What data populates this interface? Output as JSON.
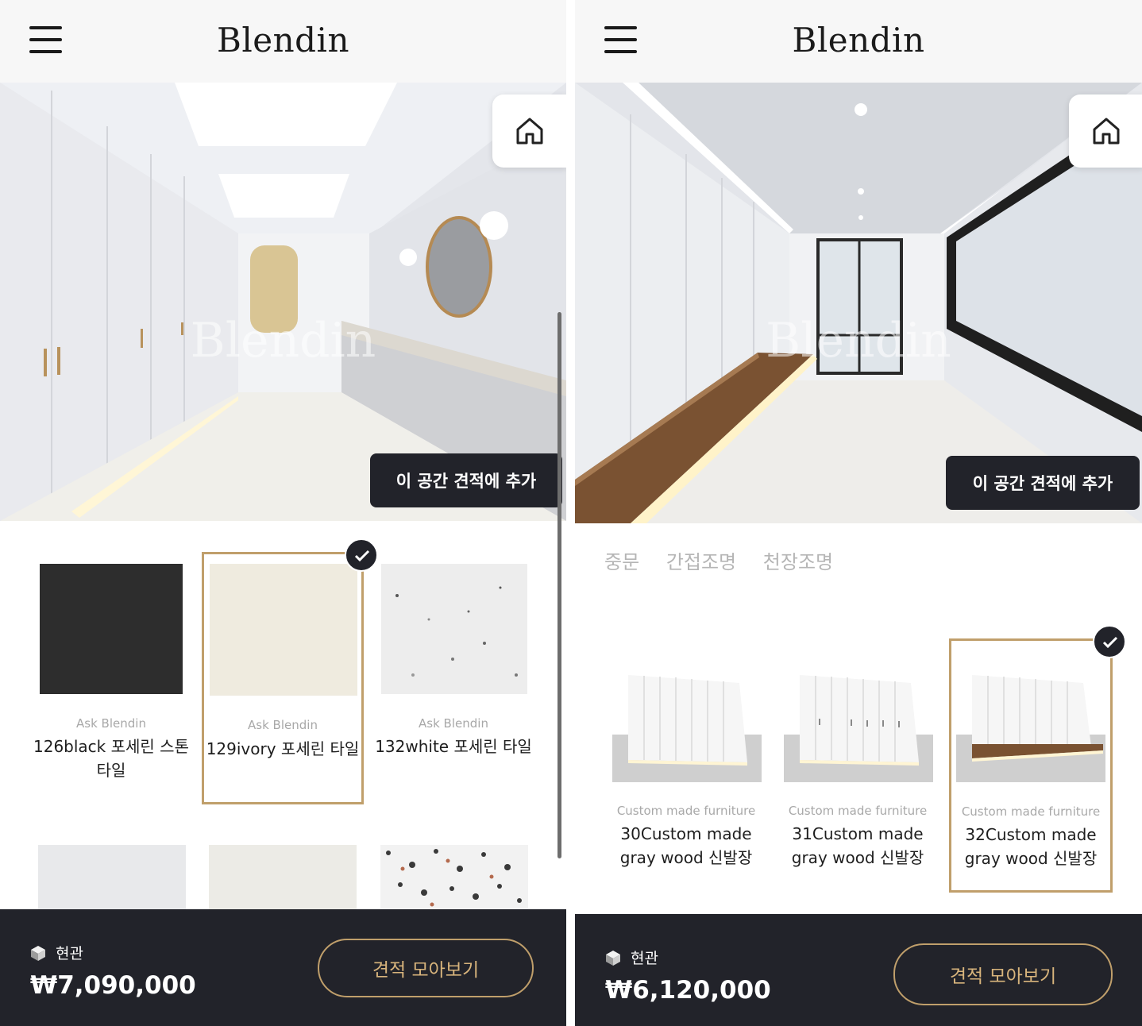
{
  "left": {
    "brand": "Blendin",
    "watermark": "Blendin",
    "add_to_quote": "이 공간 견적에 추가",
    "products": [
      {
        "brand": "Ask Blendin",
        "name": "126black 포세린 스톤 타일",
        "swatch": "#2d2d2d",
        "selected": false
      },
      {
        "brand": "Ask Blendin",
        "name": "129ivory 포세린 타일",
        "swatch": "#efebdf",
        "selected": true
      },
      {
        "brand": "Ask Blendin",
        "name": "132white 포세린 타일",
        "swatch": "#ededed",
        "selected": false
      }
    ],
    "partial_swatches": [
      "#e8e9eb",
      "#ecebe6",
      "terrazzo"
    ],
    "space": "현관",
    "price": "₩7,090,000",
    "view_quotes": "견적 모아보기"
  },
  "right": {
    "brand": "Blendin",
    "watermark": "Blendin",
    "add_to_quote": "이 공간 견적에 추가",
    "tabs": [
      "중문",
      "간접조명",
      "천장조명"
    ],
    "products": [
      {
        "brand": "Custom made furniture",
        "name": "30Custom made gray wood 신발장",
        "selected": false,
        "bench": false
      },
      {
        "brand": "Custom made furniture",
        "name": "31Custom made gray wood 신발장",
        "selected": false,
        "bench": false
      },
      {
        "brand": "Custom made furniture",
        "name": "32Custom made gray wood 신발장",
        "selected": true,
        "bench": true
      }
    ],
    "space": "현관",
    "price": "₩6,120,000",
    "view_quotes": "견적 모아보기"
  },
  "colors": {
    "accent": "#c09f6b",
    "dark": "#22232a"
  },
  "icons": [
    "menu-icon",
    "home-icon",
    "check-icon",
    "cube-icon"
  ]
}
